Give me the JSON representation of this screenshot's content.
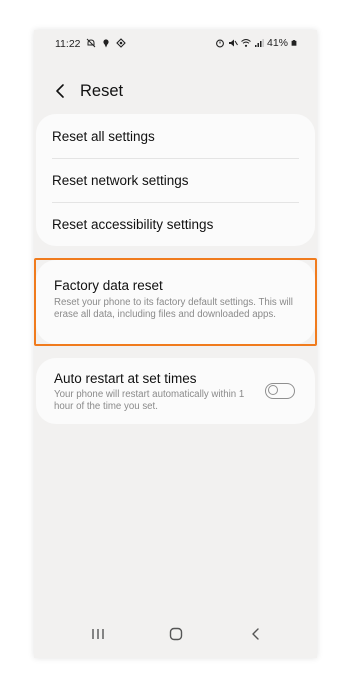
{
  "status_bar": {
    "time": "11:22",
    "battery": "41%",
    "left_icons": [
      "notifications-off-icon",
      "location-icon",
      "sync-icon"
    ],
    "right_icons": [
      "alarm-icon",
      "mute-icon",
      "wifi-icon",
      "signal-icon",
      "battery-icon"
    ]
  },
  "header": {
    "title": "Reset",
    "back_icon": "chevron-left-icon"
  },
  "reset_list": {
    "items": [
      {
        "label": "Reset all settings"
      },
      {
        "label": "Reset network settings"
      },
      {
        "label": "Reset accessibility settings"
      }
    ]
  },
  "factory_reset": {
    "title": "Factory data reset",
    "description": "Reset your phone to its factory default settings. This will erase all data, including files and downloaded apps.",
    "highlight_color": "#f07b1d"
  },
  "auto_restart": {
    "title": "Auto restart at set times",
    "description": "Your phone will restart automatically within 1 hour of the time you set.",
    "toggle_on": false
  },
  "nav_bar": {
    "buttons": [
      "recents-icon",
      "home-icon",
      "back-icon"
    ]
  },
  "colors": {
    "background": "#f2f1f0",
    "card": "#fbfbfb",
    "primary_text": "#111111",
    "secondary_text": "#8a8a8a"
  }
}
